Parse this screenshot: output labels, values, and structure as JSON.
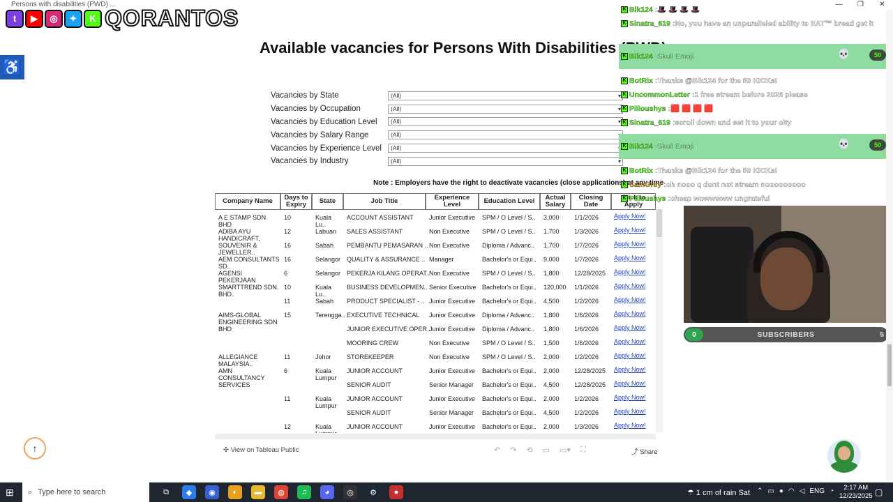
{
  "window": {
    "title": "Persons with disabilities (PWD) ...",
    "controls": [
      "—",
      "❐",
      "✕"
    ]
  },
  "streamer": {
    "brand": "QORANTOS",
    "social_icons": [
      {
        "name": "twitch-icon",
        "glyph": "t",
        "color": "#7b3fe4"
      },
      {
        "name": "youtube-icon",
        "glyph": "▶",
        "color": "#ff0000"
      },
      {
        "name": "instagram-icon",
        "glyph": "◎",
        "color": "#d62976"
      },
      {
        "name": "twitter-icon",
        "glyph": "✦",
        "color": "#1da1f2"
      },
      {
        "name": "kick-icon",
        "glyph": "K",
        "color": "#53fc18"
      }
    ]
  },
  "page": {
    "title": "Available vacancies for Persons With Disabilities (PWD)",
    "note": "Note : Employers have the right to deactivate vacancies (close applications) at any time"
  },
  "filters": [
    {
      "label": "Vacancies by State",
      "value": "(All)"
    },
    {
      "label": "Vacancies by Occupation",
      "value": "(All)"
    },
    {
      "label": "Vacancies by Education Level",
      "value": "(All)"
    },
    {
      "label": "Vacancies by Salary Range",
      "value": "(All)"
    },
    {
      "label": "Vacancies by Experience Level",
      "value": "(All)"
    },
    {
      "label": "Vacancies by Industry",
      "value": "(All)"
    }
  ],
  "table": {
    "headers": [
      "Company Name",
      "Days to Expiry",
      "State",
      "Job Title",
      "Experience Level",
      "Education Level",
      "Actual Salary",
      "Closing Date",
      "Click to Apply"
    ],
    "apply_label": "Apply Now!",
    "rows": [
      {
        "company": "A E STAMP SDN BHD",
        "days": "10",
        "state": "Kuala Lu..",
        "job": "ACCOUNT ASSISTANT",
        "exp": "Junior Executive",
        "edu": "SPM / O Level / S..",
        "salary": "3,000",
        "date": "1/1/2026"
      },
      {
        "company": "ADIBA AYU HANDICRAFT, SOUVENIR & JEWELLER..",
        "days": "12",
        "state": "Labuan",
        "job": "SALES ASSISTANT",
        "exp": "Non Executive",
        "edu": "SPM / O Level / S..",
        "salary": "1,700",
        "date": "1/3/2026"
      },
      {
        "company": "",
        "days": "16",
        "state": "Sabah",
        "job": "PEMBANTU PEMASARAN ..",
        "exp": "Non Executive",
        "edu": "Diploma / Advanc..",
        "salary": "1,700",
        "date": "1/7/2026"
      },
      {
        "company": "AEM CONSULTANTS SD..",
        "days": "16",
        "state": "Selangor",
        "job": "QUALITY & ASSURANCE ..",
        "exp": "Manager",
        "edu": "Bachelor's or Equi..",
        "salary": "9,000",
        "date": "1/7/2026"
      },
      {
        "company": "AGENSI PEKERJAAN SMARTTREND SDN. BHD.",
        "days": "6",
        "state": "Selangor",
        "job": "PEKERJA KILANG OPERAT..",
        "exp": "Non Executive",
        "edu": "SPM / O Level / S..",
        "salary": "1,800",
        "date": "12/28/2025"
      },
      {
        "company": "",
        "days": "10",
        "state": "Kuala Lu..",
        "job": "BUSINESS DEVELOPMEN..",
        "exp": "Senior Executive",
        "edu": "Bachelor's or Equi..",
        "salary": "120,000",
        "date": "1/1/2026"
      },
      {
        "company": "",
        "days": "11",
        "state": "Sabah",
        "job": "PRODUCT SPECIALIST - ..",
        "exp": "Junior Executive",
        "edu": "Bachelor's or Equi..",
        "salary": "4,500",
        "date": "1/2/2026"
      },
      {
        "company": "AIMS-GLOBAL ENGINEERING SDN BHD",
        "days": "15",
        "state": "Terengga..",
        "job": "EXECUTIVE TECHNICAL",
        "exp": "Junior Executive",
        "edu": "Diploma / Advanc..",
        "salary": "1,800",
        "date": "1/6/2026"
      },
      {
        "company": "",
        "days": "",
        "state": "",
        "job": "JUNIOR EXECUTIVE OPER..",
        "exp": "Junior Executive",
        "edu": "Diploma / Advanc..",
        "salary": "1,800",
        "date": "1/6/2026"
      },
      {
        "company": "",
        "days": "",
        "state": "",
        "job": "MOORING CREW",
        "exp": "Non Executive",
        "edu": "SPM / O Level / S..",
        "salary": "1,500",
        "date": "1/6/2026"
      },
      {
        "company": "ALLEGIANCE MALAYSIA..",
        "days": "11",
        "state": "Johor",
        "job": "STOREKEEPER",
        "exp": "Non Executive",
        "edu": "SPM / O Level / S..",
        "salary": "2,000",
        "date": "1/2/2026"
      },
      {
        "company": "AMN CONSULTANCY SERVICES",
        "days": "6",
        "state": "Kuala Lumpur",
        "job": "JUNIOR ACCOUNT",
        "exp": "Junior Executive",
        "edu": "Bachelor's or Equi..",
        "salary": "2,000",
        "date": "12/28/2025"
      },
      {
        "company": "",
        "days": "",
        "state": "",
        "job": "SENIOR AUDIT",
        "exp": "Senior Manager",
        "edu": "Bachelor's or Equi..",
        "salary": "4,500",
        "date": "12/28/2025"
      },
      {
        "company": "",
        "days": "11",
        "state": "Kuala Lumpur",
        "job": "JUNIOR ACCOUNT",
        "exp": "Junior Executive",
        "edu": "Bachelor's or Equi..",
        "salary": "2,000",
        "date": "1/2/2026"
      },
      {
        "company": "",
        "days": "",
        "state": "",
        "job": "SENIOR AUDIT",
        "exp": "Senior Manager",
        "edu": "Bachelor's or Equi..",
        "salary": "4,500",
        "date": "1/2/2026"
      },
      {
        "company": "",
        "days": "12",
        "state": "Kuala Lumpur",
        "job": "JUNIOR ACCOUNT",
        "exp": "Junior Executive",
        "edu": "Bachelor's or Equi..",
        "salary": "2,000",
        "date": "1/3/2026"
      }
    ]
  },
  "tableau": {
    "view_label": "View on Tableau Public",
    "share_label": "Share"
  },
  "chat": {
    "messages": [
      {
        "user": "Blk124",
        "sep": " : ",
        "text": "🎩 🎩 🎩 🎩",
        "highlight": false,
        "user_color": "#53fc18"
      },
      {
        "user": "Sinatra_619",
        "sep": " : ",
        "text": "No, you have an unparalleled ability to EAT™ bread get it",
        "highlight": false,
        "user_color": "#53fc18"
      },
      {
        "user": "Blk124",
        "sep": " - ",
        "text": "Skull Emoji",
        "highlight": true,
        "pill": "50",
        "user_color": "#53fc18"
      },
      {
        "user": "BotRix",
        "sep": " : ",
        "text": "Thanks @Blk124 for the 50 KICKs!",
        "highlight": false,
        "user_color": "#53fc18"
      },
      {
        "user": "UncommonLetter",
        "sep": " : ",
        "text": "1 free stream before 2026 please",
        "highlight": false,
        "user_color": "#53fc18"
      },
      {
        "user": "Pilloushys",
        "sep": " : ",
        "text": "🟥 🟥 🟥 🟥",
        "highlight": false,
        "user_color": "#53fc18"
      },
      {
        "user": "Sinatra_619",
        "sep": " : ",
        "text": "scroll down and set it to your city",
        "highlight": false,
        "user_color": "#53fc18"
      },
      {
        "user": "Blk124",
        "sep": " - ",
        "text": "Skull Emoji",
        "highlight": true,
        "pill": "50",
        "user_color": "#53fc18"
      },
      {
        "user": "BotRix",
        "sep": " : ",
        "text": "Thanks @Blk124 for the 50 KICKs!",
        "highlight": false,
        "user_color": "#53fc18"
      },
      {
        "user": "SamGrey",
        "sep": " : ",
        "text": "oh nooo q dont not stream nooooooooo",
        "highlight": false,
        "user_color": "#e0a020"
      },
      {
        "user": "Pilloushys",
        "sep": " : ",
        "text": "cheap wowwwww ungrateful",
        "highlight": false,
        "user_color": "#53fc18"
      }
    ]
  },
  "subscribers": {
    "current": "0",
    "label": "SUBSCRIBERS",
    "goal": "5"
  },
  "taskbar": {
    "search_placeholder": "Type here to search",
    "weather": "1 cm of rain Sat",
    "language": "ENG",
    "time": "2:17 AM",
    "date": "12/23/2025",
    "apps": [
      {
        "name": "task-view-icon",
        "glyph": "⧉",
        "color": "transparent"
      },
      {
        "name": "copilot-icon",
        "glyph": "◆",
        "color": "#2b7de9"
      },
      {
        "name": "app-icon",
        "glyph": "◉",
        "color": "#3a5fd0"
      },
      {
        "name": "chrome-icon",
        "glyph": "◐",
        "color": "#e8a020"
      },
      {
        "name": "file-explorer-icon",
        "glyph": "▬",
        "color": "#e8b830"
      },
      {
        "name": "chrome-icon",
        "glyph": "◍",
        "color": "#db4437"
      },
      {
        "name": "spotify-icon",
        "glyph": "♫",
        "color": "#1db954"
      },
      {
        "name": "discord-icon",
        "glyph": "◕",
        "color": "#5865f2"
      },
      {
        "name": "obs-icon",
        "glyph": "◎",
        "color": "#333"
      },
      {
        "name": "steam-icon",
        "glyph": "⚙",
        "color": "#1b2838"
      },
      {
        "name": "record-icon",
        "glyph": "●",
        "color": "#c23030"
      }
    ]
  }
}
